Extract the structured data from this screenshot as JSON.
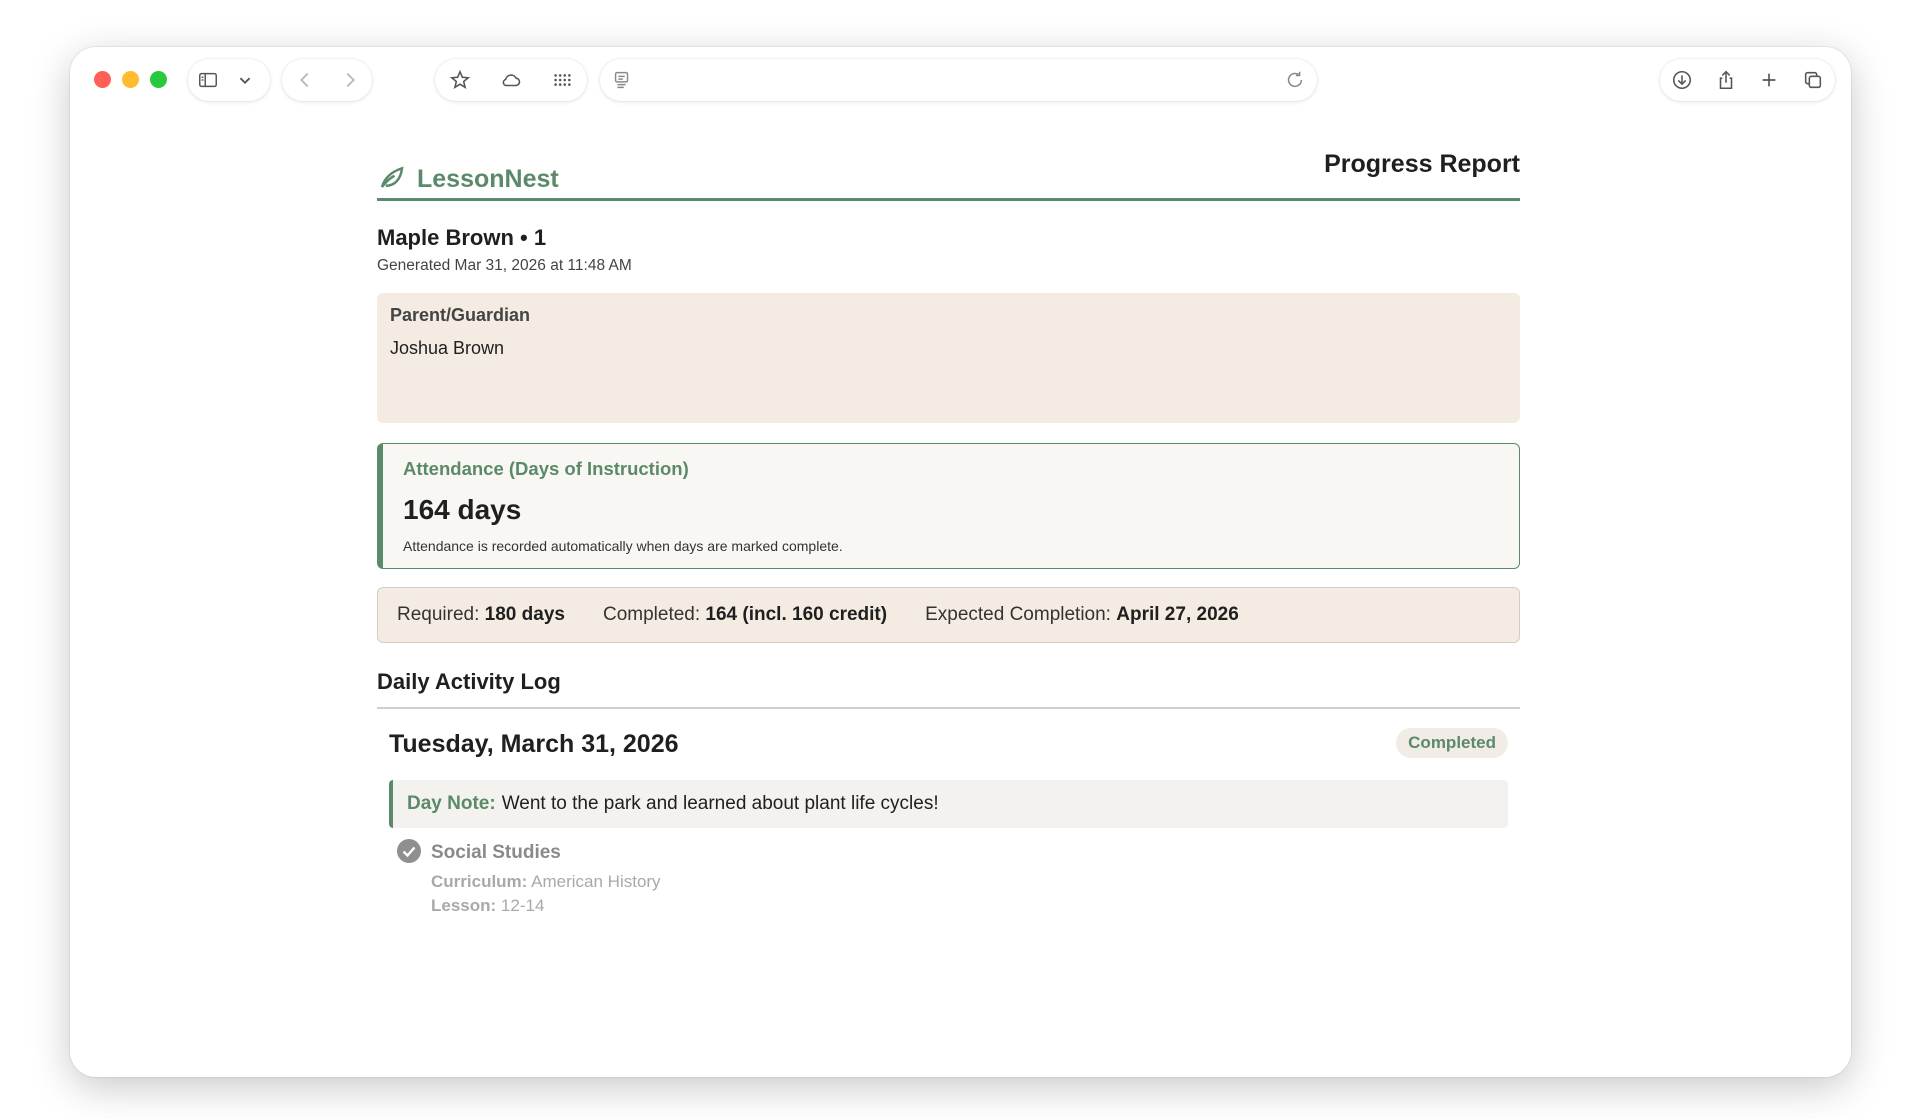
{
  "browser": {
    "toolbar_icons": [
      "sidebar-icon",
      "chevron-down-icon",
      "back-arrow-icon",
      "forward-arrow-icon",
      "star-icon",
      "cloud-icon",
      "grid-icon",
      "reader-icon",
      "reload-icon",
      "download-icon",
      "share-icon",
      "plus-icon",
      "tabs-icon"
    ]
  },
  "colors": {
    "accent": "#5b8a6a",
    "panel": "#f4ece3"
  },
  "header": {
    "brand_name": "LessonNest",
    "report_title": "Progress Report"
  },
  "student": {
    "name_line": "Maple Brown • 1",
    "generated": "Generated Mar 31, 2026 at 11:48 AM"
  },
  "guardian": {
    "label": "Parent/Guardian",
    "name": "Joshua Brown"
  },
  "attendance": {
    "title": "Attendance (Days of Instruction)",
    "value": "164 days",
    "note": "Attendance is recorded automatically when days are marked complete."
  },
  "summary": {
    "required_label": "Required:",
    "required_value": "180 days",
    "completed_label": "Completed:",
    "completed_value": "164 (incl. 160 credit)",
    "expected_label": "Expected Completion:",
    "expected_value": "April 27, 2026"
  },
  "log": {
    "section_title": "Daily Activity Log",
    "day_title": "Tuesday, March 31, 2026",
    "status": "Completed",
    "note_label": "Day Note:",
    "note_text": "Went to the park and learned about plant life cycles!",
    "activity": {
      "subject": "Social Studies",
      "curriculum_label": "Curriculum:",
      "curriculum_value": "American History",
      "lesson_label": "Lesson:",
      "lesson_value": "12-14"
    }
  }
}
